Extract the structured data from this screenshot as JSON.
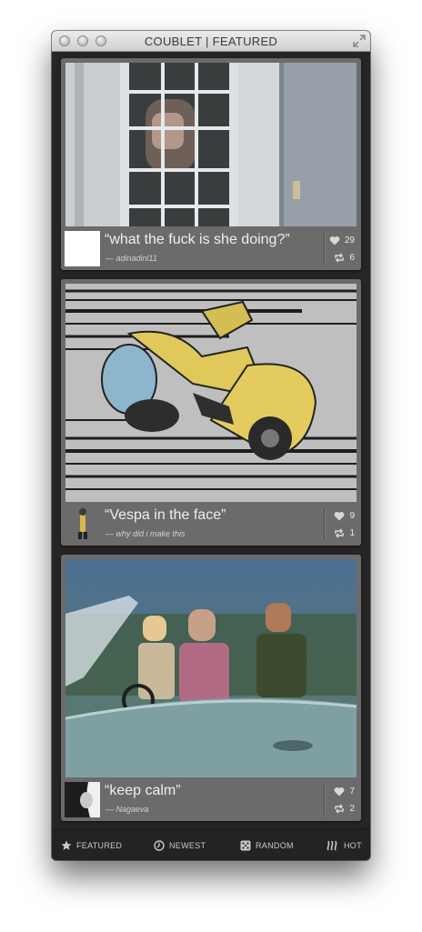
{
  "window": {
    "title": "COUBLET | FEATURED"
  },
  "cards": [
    {
      "caption": "“what the fuck is she doing?”",
      "user": "— adinadinl11",
      "likes": "29",
      "recoubs": "6"
    },
    {
      "caption": "“Vespa in the face”",
      "user": "— why did i make this",
      "likes": "9",
      "recoubs": "1"
    },
    {
      "caption": "“keep calm”",
      "user": "— Nagaeva",
      "likes": "7",
      "recoubs": "2"
    }
  ],
  "tabs": [
    {
      "label": "FEATURED",
      "icon": "star-icon"
    },
    {
      "label": "NEWEST",
      "icon": "clock-icon"
    },
    {
      "label": "RANDOM",
      "icon": "dice-icon"
    },
    {
      "label": "HOT",
      "icon": "heat-icon"
    }
  ],
  "colors": {
    "window_bg": "#262626",
    "card_bg": "#6b6b6b",
    "tab_text": "#c9c9c9"
  }
}
